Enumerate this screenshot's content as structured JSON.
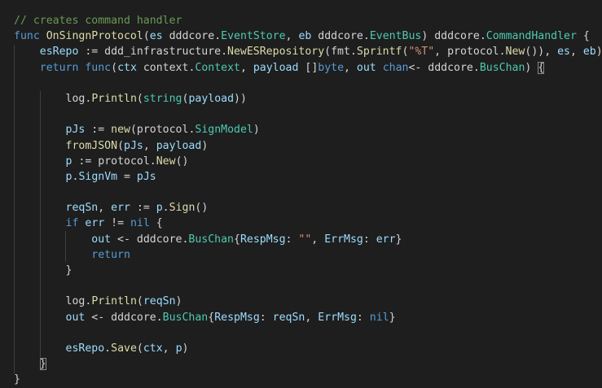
{
  "editor": {
    "theme": "dark",
    "colors": {
      "background": "#1e1e1e",
      "comment": "#6a9955",
      "keyword": "#569cd6",
      "function": "#dcdcaa",
      "type": "#4ec9b0",
      "variable": "#9cdcfe",
      "string": "#ce9178",
      "plain": "#d4d4d4"
    },
    "lines": [
      [
        {
          "t": "// creates command handler",
          "c": "comment"
        }
      ],
      [
        {
          "t": "func",
          "c": "keyword"
        },
        {
          "t": " ",
          "c": "plain"
        },
        {
          "t": "OnSingnProtocol",
          "c": "func"
        },
        {
          "t": "(",
          "c": "plain"
        },
        {
          "t": "es",
          "c": "var"
        },
        {
          "t": " ",
          "c": "plain"
        },
        {
          "t": "dddcore",
          "c": "plain"
        },
        {
          "t": ".",
          "c": "plain"
        },
        {
          "t": "EventStore",
          "c": "type"
        },
        {
          "t": ", ",
          "c": "plain"
        },
        {
          "t": "eb",
          "c": "var"
        },
        {
          "t": " ",
          "c": "plain"
        },
        {
          "t": "dddcore",
          "c": "plain"
        },
        {
          "t": ".",
          "c": "plain"
        },
        {
          "t": "EventBus",
          "c": "type"
        },
        {
          "t": ") ",
          "c": "plain"
        },
        {
          "t": "dddcore",
          "c": "plain"
        },
        {
          "t": ".",
          "c": "plain"
        },
        {
          "t": "CommandHandler",
          "c": "type"
        },
        {
          "t": " {",
          "c": "plain"
        }
      ],
      [
        {
          "t": "    ",
          "c": "plain"
        },
        {
          "t": "esRepo",
          "c": "var"
        },
        {
          "t": " := ",
          "c": "plain"
        },
        {
          "t": "ddd_infrastructure",
          "c": "plain"
        },
        {
          "t": ".",
          "c": "plain"
        },
        {
          "t": "NewESRepository",
          "c": "func"
        },
        {
          "t": "(",
          "c": "plain"
        },
        {
          "t": "fmt",
          "c": "plain"
        },
        {
          "t": ".",
          "c": "plain"
        },
        {
          "t": "Sprintf",
          "c": "func"
        },
        {
          "t": "(",
          "c": "plain"
        },
        {
          "t": "\"%T\"",
          "c": "string"
        },
        {
          "t": ", ",
          "c": "plain"
        },
        {
          "t": "protocol",
          "c": "plain"
        },
        {
          "t": ".",
          "c": "plain"
        },
        {
          "t": "New",
          "c": "func"
        },
        {
          "t": "()), ",
          "c": "plain"
        },
        {
          "t": "es",
          "c": "var"
        },
        {
          "t": ", ",
          "c": "plain"
        },
        {
          "t": "eb",
          "c": "var"
        },
        {
          "t": ")",
          "c": "plain"
        }
      ],
      [
        {
          "t": "    ",
          "c": "plain"
        },
        {
          "t": "return",
          "c": "keyword"
        },
        {
          "t": " ",
          "c": "plain"
        },
        {
          "t": "func",
          "c": "keyword"
        },
        {
          "t": "(",
          "c": "plain"
        },
        {
          "t": "ctx",
          "c": "var"
        },
        {
          "t": " ",
          "c": "plain"
        },
        {
          "t": "context",
          "c": "plain"
        },
        {
          "t": ".",
          "c": "plain"
        },
        {
          "t": "Context",
          "c": "type"
        },
        {
          "t": ", ",
          "c": "plain"
        },
        {
          "t": "payload",
          "c": "var"
        },
        {
          "t": " []",
          "c": "plain"
        },
        {
          "t": "byte",
          "c": "keyword"
        },
        {
          "t": ", ",
          "c": "plain"
        },
        {
          "t": "out",
          "c": "var"
        },
        {
          "t": " ",
          "c": "plain"
        },
        {
          "t": "chan",
          "c": "keyword"
        },
        {
          "t": "<- ",
          "c": "plain"
        },
        {
          "t": "dddcore",
          "c": "plain"
        },
        {
          "t": ".",
          "c": "plain"
        },
        {
          "t": "BusChan",
          "c": "type"
        },
        {
          "t": ") ",
          "c": "plain"
        },
        {
          "t": "{",
          "c": "plain",
          "m": true
        }
      ],
      [],
      [
        {
          "t": "        ",
          "c": "plain"
        },
        {
          "t": "log",
          "c": "plain"
        },
        {
          "t": ".",
          "c": "plain"
        },
        {
          "t": "Println",
          "c": "func"
        },
        {
          "t": "(",
          "c": "plain"
        },
        {
          "t": "string",
          "c": "type"
        },
        {
          "t": "(",
          "c": "plain"
        },
        {
          "t": "payload",
          "c": "var"
        },
        {
          "t": "))",
          "c": "plain"
        }
      ],
      [],
      [
        {
          "t": "        ",
          "c": "plain"
        },
        {
          "t": "pJs",
          "c": "var"
        },
        {
          "t": " := ",
          "c": "plain"
        },
        {
          "t": "new",
          "c": "func"
        },
        {
          "t": "(",
          "c": "plain"
        },
        {
          "t": "protocol",
          "c": "plain"
        },
        {
          "t": ".",
          "c": "plain"
        },
        {
          "t": "SignModel",
          "c": "type"
        },
        {
          "t": ")",
          "c": "plain"
        }
      ],
      [
        {
          "t": "        ",
          "c": "plain"
        },
        {
          "t": "fromJSON",
          "c": "func"
        },
        {
          "t": "(",
          "c": "plain"
        },
        {
          "t": "pJs",
          "c": "var"
        },
        {
          "t": ", ",
          "c": "plain"
        },
        {
          "t": "payload",
          "c": "var"
        },
        {
          "t": ")",
          "c": "plain"
        }
      ],
      [
        {
          "t": "        ",
          "c": "plain"
        },
        {
          "t": "p",
          "c": "var"
        },
        {
          "t": " := ",
          "c": "plain"
        },
        {
          "t": "protocol",
          "c": "plain"
        },
        {
          "t": ".",
          "c": "plain"
        },
        {
          "t": "New",
          "c": "func"
        },
        {
          "t": "()",
          "c": "plain"
        }
      ],
      [
        {
          "t": "        ",
          "c": "plain"
        },
        {
          "t": "p",
          "c": "var"
        },
        {
          "t": ".",
          "c": "plain"
        },
        {
          "t": "SignVm",
          "c": "var"
        },
        {
          "t": " = ",
          "c": "plain"
        },
        {
          "t": "pJs",
          "c": "var"
        }
      ],
      [],
      [
        {
          "t": "        ",
          "c": "plain"
        },
        {
          "t": "reqSn",
          "c": "var"
        },
        {
          "t": ", ",
          "c": "plain"
        },
        {
          "t": "err",
          "c": "var"
        },
        {
          "t": " := ",
          "c": "plain"
        },
        {
          "t": "p",
          "c": "var"
        },
        {
          "t": ".",
          "c": "plain"
        },
        {
          "t": "Sign",
          "c": "func"
        },
        {
          "t": "()",
          "c": "plain"
        }
      ],
      [
        {
          "t": "        ",
          "c": "plain"
        },
        {
          "t": "if",
          "c": "keyword"
        },
        {
          "t": " ",
          "c": "plain"
        },
        {
          "t": "err",
          "c": "var"
        },
        {
          "t": " != ",
          "c": "plain"
        },
        {
          "t": "nil",
          "c": "keyword"
        },
        {
          "t": " {",
          "c": "plain"
        }
      ],
      [
        {
          "t": "            ",
          "c": "plain"
        },
        {
          "t": "out",
          "c": "var"
        },
        {
          "t": " <- ",
          "c": "plain"
        },
        {
          "t": "dddcore",
          "c": "plain"
        },
        {
          "t": ".",
          "c": "plain"
        },
        {
          "t": "BusChan",
          "c": "type"
        },
        {
          "t": "{",
          "c": "plain"
        },
        {
          "t": "RespMsg",
          "c": "var"
        },
        {
          "t": ": ",
          "c": "plain"
        },
        {
          "t": "\"\"",
          "c": "string"
        },
        {
          "t": ", ",
          "c": "plain"
        },
        {
          "t": "ErrMsg",
          "c": "var"
        },
        {
          "t": ": ",
          "c": "plain"
        },
        {
          "t": "err",
          "c": "var"
        },
        {
          "t": "}",
          "c": "plain"
        }
      ],
      [
        {
          "t": "            ",
          "c": "plain"
        },
        {
          "t": "return",
          "c": "keyword"
        }
      ],
      [
        {
          "t": "        ",
          "c": "plain"
        },
        {
          "t": "}",
          "c": "plain"
        }
      ],
      [],
      [
        {
          "t": "        ",
          "c": "plain"
        },
        {
          "t": "log",
          "c": "plain"
        },
        {
          "t": ".",
          "c": "plain"
        },
        {
          "t": "Println",
          "c": "func"
        },
        {
          "t": "(",
          "c": "plain"
        },
        {
          "t": "reqSn",
          "c": "var"
        },
        {
          "t": ")",
          "c": "plain"
        }
      ],
      [
        {
          "t": "        ",
          "c": "plain"
        },
        {
          "t": "out",
          "c": "var"
        },
        {
          "t": " <- ",
          "c": "plain"
        },
        {
          "t": "dddcore",
          "c": "plain"
        },
        {
          "t": ".",
          "c": "plain"
        },
        {
          "t": "BusChan",
          "c": "type"
        },
        {
          "t": "{",
          "c": "plain"
        },
        {
          "t": "RespMsg",
          "c": "var"
        },
        {
          "t": ": ",
          "c": "plain"
        },
        {
          "t": "reqSn",
          "c": "var"
        },
        {
          "t": ", ",
          "c": "plain"
        },
        {
          "t": "ErrMsg",
          "c": "var"
        },
        {
          "t": ": ",
          "c": "plain"
        },
        {
          "t": "nil",
          "c": "keyword"
        },
        {
          "t": "}",
          "c": "plain"
        }
      ],
      [],
      [
        {
          "t": "        ",
          "c": "plain"
        },
        {
          "t": "esRepo",
          "c": "var"
        },
        {
          "t": ".",
          "c": "plain"
        },
        {
          "t": "Save",
          "c": "func"
        },
        {
          "t": "(",
          "c": "plain"
        },
        {
          "t": "ctx",
          "c": "var"
        },
        {
          "t": ", ",
          "c": "plain"
        },
        {
          "t": "p",
          "c": "var"
        },
        {
          "t": ")",
          "c": "plain"
        }
      ],
      [
        {
          "t": "    ",
          "c": "plain"
        },
        {
          "t": "}",
          "c": "plain",
          "m": true
        }
      ],
      [
        {
          "t": "}",
          "c": "plain"
        }
      ]
    ]
  }
}
